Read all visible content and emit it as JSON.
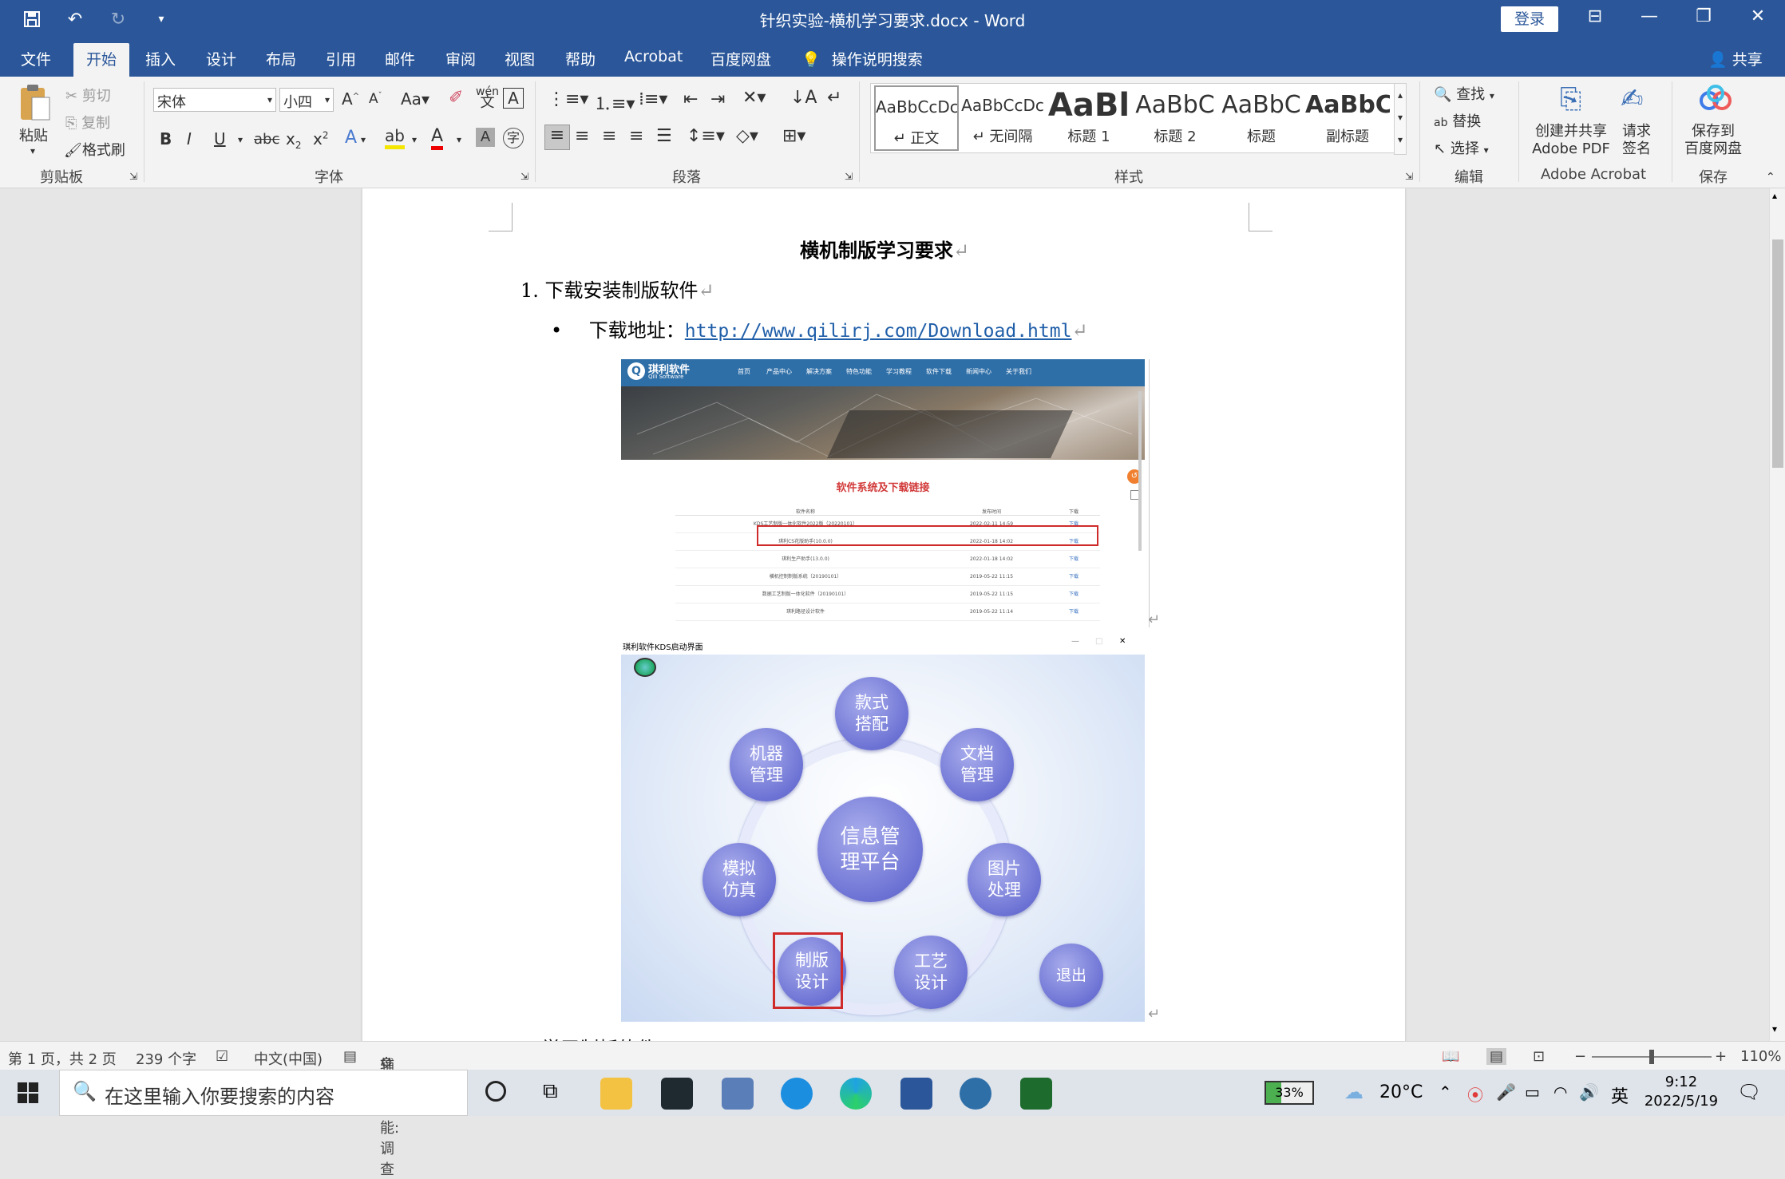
{
  "window": {
    "title": "针织实验-横机学习要求.docx  -  Word",
    "login": "登录"
  },
  "menu": {
    "tabs": [
      "文件",
      "开始",
      "插入",
      "设计",
      "布局",
      "引用",
      "邮件",
      "审阅",
      "视图",
      "帮助",
      "Acrobat",
      "百度网盘"
    ],
    "search": "操作说明搜索",
    "share": "共享"
  },
  "ribbon": {
    "clipboard": {
      "paste": "粘贴",
      "cut": "剪切",
      "copy": "复制",
      "format_painter": "格式刷",
      "label": "剪贴板"
    },
    "font": {
      "name": "宋体",
      "size": "小四",
      "label": "字体"
    },
    "paragraph": {
      "label": "段落"
    },
    "styles": {
      "label": "样式",
      "items": [
        {
          "preview": "AaBbCcDc",
          "label": "↵ 正文"
        },
        {
          "preview": "AaBbCcDc",
          "label": "↵ 无间隔"
        },
        {
          "preview": "AaBl",
          "label": "标题 1"
        },
        {
          "preview": "AaBbC",
          "label": "标题 2"
        },
        {
          "preview": "AaBbC",
          "label": "标题"
        },
        {
          "preview": "AaBbC",
          "label": "副标题"
        }
      ]
    },
    "editing": {
      "find": "查找",
      "replace": "替换",
      "select": "选择",
      "label": "编辑"
    },
    "acrobat": {
      "create": "创建并共享",
      "create2": "Adobe PDF",
      "sign": "请求",
      "sign2": "签名",
      "label": "Adobe Acrobat"
    },
    "save": {
      "btn": "保存到",
      "btn2": "百度网盘",
      "label": "保存"
    }
  },
  "document": {
    "heading": "横机制版学习要求",
    "item1": "1. 下载安装制版软件",
    "bullet_label": "下载地址：",
    "url": "http://www.qilirj.com/Download.html",
    "footer_partial": "学习制板软件……"
  },
  "screenshot1": {
    "brand": "琪利软件",
    "brand_sub": "Qili Software",
    "nav": [
      "首页",
      "产品中心",
      "解决方案",
      "特色功能",
      "学习教程",
      "软件下载",
      "新闻中心",
      "关于我们"
    ],
    "section_title": "软件系统及下载链接",
    "headers": [
      "软件名称",
      "发布时间",
      "下载"
    ],
    "rows": [
      {
        "name": "KDS工艺制版一体化软件2022版（20220101）",
        "date": "2022-02-11 14:59",
        "dl": "下载"
      },
      {
        "name": "琪利CS花版助手(10.0.0)",
        "date": "2022-01-18 14:02",
        "dl": "下载"
      },
      {
        "name": "琪利生产助手(13.0.0)",
        "date": "2022-01-18 14:02",
        "dl": "下载"
      },
      {
        "name": "横机控制制版系统（20190101）",
        "date": "2019-05-22 11:15",
        "dl": "下载"
      },
      {
        "name": "数据工艺制版一体化软件（20190101）",
        "date": "2019-05-22 11:15",
        "dl": "下载"
      },
      {
        "name": "琪利路径设计软件",
        "date": "2019-05-22 11:14",
        "dl": "下载"
      }
    ]
  },
  "screenshot2": {
    "title": "琪利软件KDS启动界面",
    "center": "信息管\n理平台",
    "bubbles": [
      "款式\n搭配",
      "文档\n管理",
      "图片\n处理",
      "工艺\n设计",
      "制版\n设计",
      "模拟\n仿真",
      "机器\n管理"
    ],
    "exit": "退出"
  },
  "status": {
    "page": "第 1 页，共 2 页",
    "words": "239 个字",
    "lang": "中文(中国)",
    "access": "辅助功能: 调查",
    "zoom": "110%"
  },
  "taskbar": {
    "search": "在这里输入你要搜索的内容",
    "battery": "33%",
    "weather": "20°C",
    "ime": "英",
    "time": "9:12",
    "date": "2022/5/19"
  }
}
